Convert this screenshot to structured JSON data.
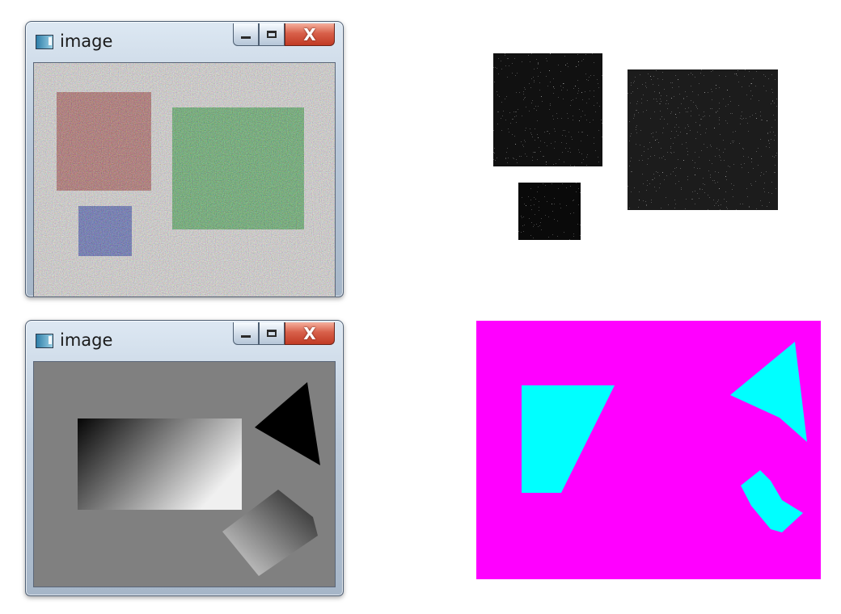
{
  "windows": [
    {
      "title": "image",
      "icon": "image-window-icon"
    },
    {
      "title": "image",
      "icon": "image-window-icon"
    }
  ],
  "window_controls": {
    "minimize": "minimize-icon",
    "maximize": "maximize-icon",
    "close": "close-icon",
    "close_glyph": "X"
  },
  "colors": {
    "noise_red": "#a0403c",
    "noise_green": "#2e9a3a",
    "noise_blue": "#2c3ea6",
    "gray_bg": "#808080",
    "magenta": "#ff00ff",
    "cyan": "#00ffff"
  }
}
